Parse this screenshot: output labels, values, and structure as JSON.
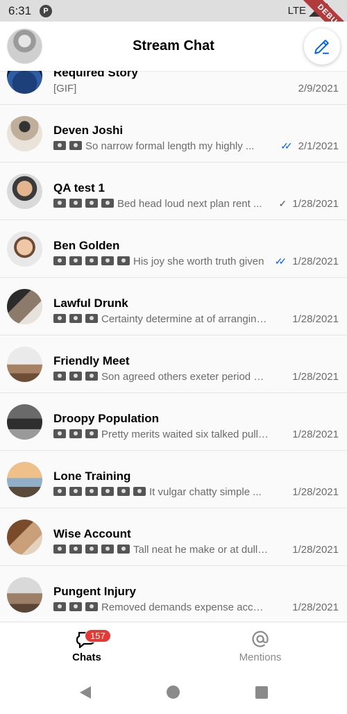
{
  "status_bar": {
    "time": "6:31",
    "network": "LTE",
    "debug_label": "DEBUG"
  },
  "app_bar": {
    "title": "Stream Chat"
  },
  "channels": [
    {
      "name": "Required Story",
      "preview": "[GIF]",
      "cams": 0,
      "tick": "",
      "date": "2/9/2021"
    },
    {
      "name": "Deven Joshi",
      "preview": "So narrow formal length my highly ...",
      "cams": 2,
      "tick": "double-blue",
      "date": "2/1/2021"
    },
    {
      "name": "QA test 1",
      "preview": "Bed head loud next plan rent ...",
      "cams": 4,
      "tick": "single-grey",
      "date": "1/28/2021"
    },
    {
      "name": "Ben Golden",
      "preview": "His joy she worth truth given",
      "cams": 5,
      "tick": "double-blue",
      "date": "1/28/2021"
    },
    {
      "name": "Lawful Drunk",
      "preview": "Certainty determine at of arranging ...",
      "cams": 3,
      "tick": "",
      "date": "1/28/2021"
    },
    {
      "name": "Friendly Meet",
      "preview": "Son agreed others exeter period myse...",
      "cams": 3,
      "tick": "",
      "date": "1/28/2021"
    },
    {
      "name": "Droopy Population",
      "preview": "Pretty merits waited six talked pulled ...",
      "cams": 3,
      "tick": "",
      "date": "1/28/2021"
    },
    {
      "name": "Lone Training",
      "preview": "It vulgar chatty simple ...",
      "cams": 6,
      "tick": "",
      "date": "1/28/2021"
    },
    {
      "name": "Wise Account",
      "preview": "Tall neat he make or at dull ye",
      "cams": 5,
      "tick": "",
      "date": "1/28/2021"
    },
    {
      "name": "Pungent Injury",
      "preview": "Removed demands expense account i...",
      "cams": 3,
      "tick": "",
      "date": "1/28/2021"
    }
  ],
  "bottom_nav": {
    "chats_label": "Chats",
    "chats_badge": "157",
    "mentions_label": "Mentions"
  },
  "colors": {
    "accent": "#005fff",
    "badge": "#e53935",
    "double_tick": "#005fff",
    "single_tick": "#555555"
  }
}
